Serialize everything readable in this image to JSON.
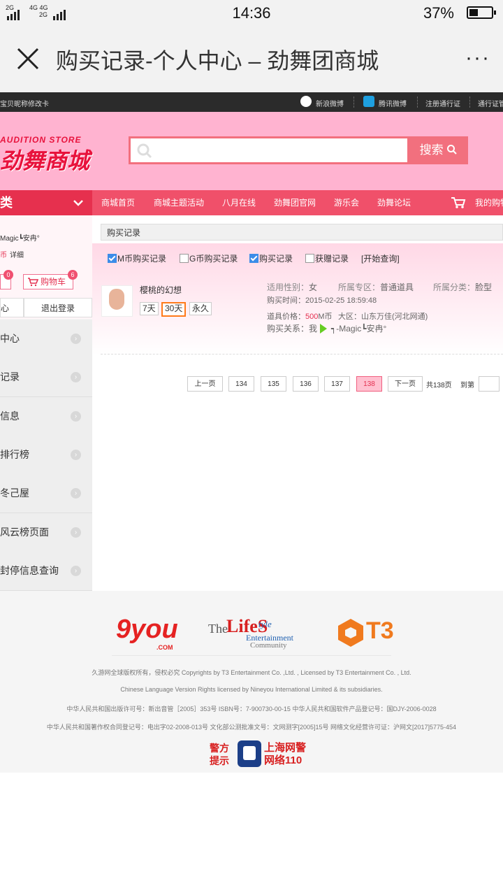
{
  "status": {
    "net_left": "2G",
    "net_mid": "4G 4G",
    "net_mid2": "2G",
    "time": "14:36",
    "battery": "37%",
    "battery_level": 0.37
  },
  "browser": {
    "title": "购买记录-个人中心 – 劲舞团商城",
    "more": "···"
  },
  "topstrip": {
    "left": "宝贝昵称修改卡",
    "weibo": "新浪微博",
    "tencent": "腾讯微博",
    "register": "注册通行证",
    "pass": "通行证管"
  },
  "header": {
    "logo_en": "AUDITION STORE",
    "logo_zh": "劲舞商城",
    "search_placeholder": "",
    "search_btn": "搜索"
  },
  "nav": {
    "category": "类",
    "items": [
      "商城首页",
      "商城主题活动",
      "八月在线",
      "劲舞团官网",
      "游乐会",
      "劲舞论坛"
    ],
    "cart": "我的购物"
  },
  "sidebar": {
    "username": "Magic┗安冉°",
    "coin_label": "币",
    "detail": "详细",
    "badge1": "0",
    "cart_label": "购物车",
    "badge2": "6",
    "center": "心",
    "logout": "退出登录",
    "menu": [
      "中心",
      "记录",
      "信息",
      "排行榜",
      "冬己屋",
      "风云榜页面",
      "封停信息查询"
    ]
  },
  "main": {
    "crumb": "购买记录",
    "filters": [
      {
        "label": "M币购买记录",
        "checked": true
      },
      {
        "label": "G币购买记录",
        "checked": false
      },
      {
        "label": "购买记录",
        "checked": true
      },
      {
        "label": "获赠记录",
        "checked": false
      }
    ],
    "query": "[开始查询]",
    "item": {
      "name": "樱桃的幻想",
      "durations": [
        "7天",
        "30天",
        "永久"
      ],
      "gender_label": "适用性别：",
      "gender": "女",
      "zone_label": "所属专区：",
      "zone": "普通道具",
      "cat_label": "所属分类：",
      "cat": "脸型",
      "time_label": "购买时间：",
      "time": "2015-02-25 18:59:48",
      "price_label": "道具价格：",
      "price": "500",
      "price_unit": "M币",
      "region_label": "大区：",
      "region": "山东万佳(河北网通)",
      "relation_label": "购买关系：",
      "relation_me": "我",
      "relation_to": "┑-Magic┗安冉°"
    },
    "pager": {
      "prev": "上一页",
      "pages": [
        "134",
        "135",
        "136",
        "137",
        "138"
      ],
      "current": "138",
      "next": "下一页",
      "total": "共138页",
      "goto": "到第"
    }
  },
  "footer": {
    "logo1": "9you",
    "logo1_sub": ".COM",
    "logo2_a": "The",
    "logo2_b": "LifeS",
    "logo2_c": "tyle",
    "logo2_d": "Entertainment",
    "logo2_e": "Community",
    "logo3": "T3",
    "line1": "久游网全球版权所有，侵权必究 Copyrights by T3 Entertainment Co. ,Ltd. , Licensed by T3 Entertainment Co. , Ltd.",
    "line2": "Chinese Language Version Rights licensed by Nineyou International Limited & its subsidiaries.",
    "line3": "中华人民共和国出版许可号：新出音管［2005］353号 ISBN号：7-900730-00-15 中华人民共和国软件产品登记号：国DJY-2006-0028",
    "line4": "中华人民共和国著作权合同登记号：电出字02-2008-013号 文化部公测批准文号：文网测字[2005]15号 网络文化经营许可证：沪网文[2017]5775-454",
    "police_l1": "警方",
    "police_l2": "提示",
    "police_r1": "上海网警",
    "police_r2": "网络110"
  }
}
